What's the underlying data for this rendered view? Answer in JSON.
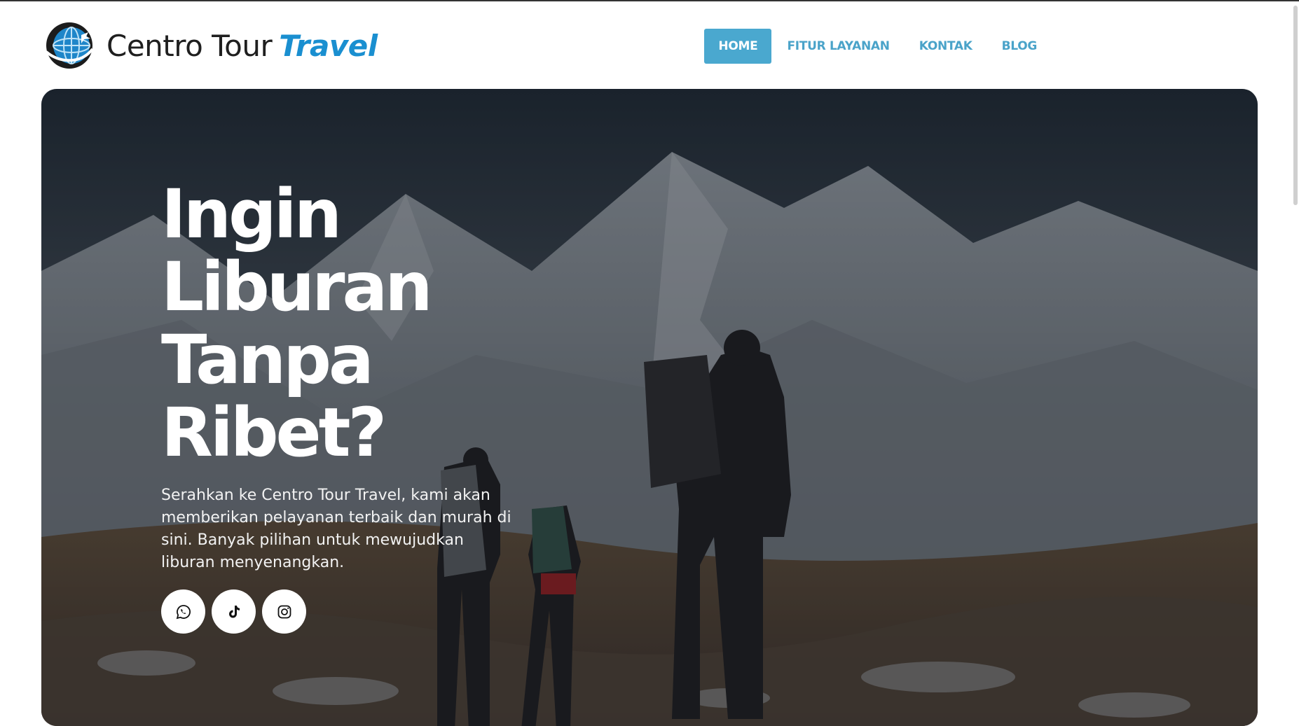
{
  "brand": {
    "name": "Centro Tour",
    "accent": "Travel",
    "logo_icon": "globe-plane-icon",
    "accent_color": "#1a8fd0"
  },
  "nav": {
    "items": [
      {
        "label": "HOME",
        "active": true
      },
      {
        "label": "FITUR LAYANAN",
        "active": false
      },
      {
        "label": "KONTAK",
        "active": false
      },
      {
        "label": "BLOG",
        "active": false
      }
    ],
    "active_color": "#4aa8cf"
  },
  "hero": {
    "title_line1": "Ingin Liburan",
    "title_line2": "Tanpa Ribet?",
    "description": "Serahkan ke Centro Tour Travel, kami akan memberikan pelayanan terbaik dan murah di sini. Banyak pilihan untuk mewujudkan liburan menyenangkan.",
    "socials": [
      {
        "name": "whatsapp",
        "icon": "whatsapp-icon"
      },
      {
        "name": "tiktok",
        "icon": "tiktok-icon"
      },
      {
        "name": "instagram",
        "icon": "instagram-icon"
      }
    ]
  }
}
